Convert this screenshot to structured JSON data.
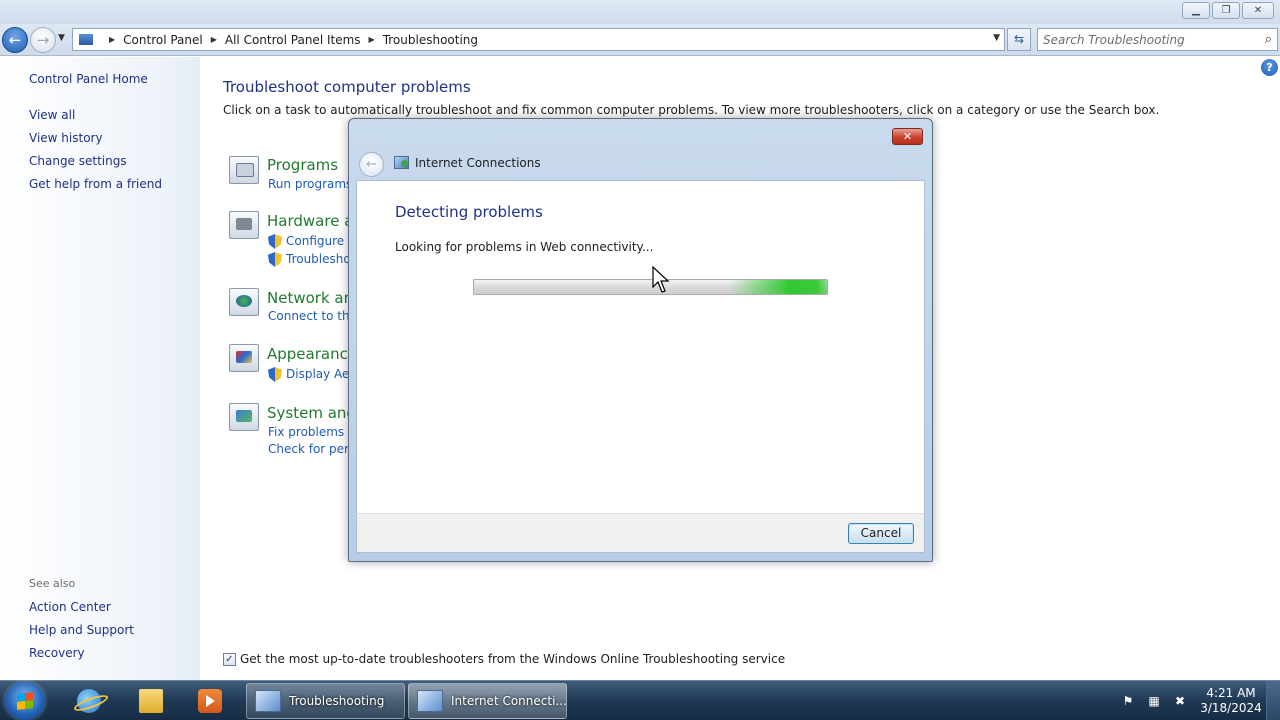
{
  "address": {
    "crumbs": [
      "Control Panel",
      "All Control Panel Items",
      "Troubleshooting"
    ],
    "search_placeholder": "Search Troubleshooting"
  },
  "left_pane": {
    "home": "Control Panel Home",
    "links": [
      "View all",
      "View history",
      "Change settings",
      "Get help from a friend"
    ],
    "see_also_label": "See also",
    "see_also": [
      "Action Center",
      "Help and Support",
      "Recovery"
    ]
  },
  "main": {
    "title": "Troubleshoot computer problems",
    "description": "Click on a task to automatically troubleshoot and fix common computer problems. To view more troubleshooters, click on a category or use the Search box.",
    "categories": [
      {
        "title": "Programs",
        "links": [
          "Run programs"
        ]
      },
      {
        "title": "Hardware a",
        "links": [
          "Configure a",
          "Troublesho"
        ]
      },
      {
        "title": "Network an",
        "links": [
          "Connect to the"
        ]
      },
      {
        "title": "Appearance",
        "links": [
          "Display Aero"
        ]
      },
      {
        "title": "System and",
        "links": [
          "Fix problems w",
          "Check for perfo"
        ]
      }
    ],
    "footer_checkbox_label": "Get the most up-to-date troubleshooters from the Windows Online Troubleshooting service",
    "footer_checked": true
  },
  "dialog": {
    "title": "Internet Connections",
    "heading": "Detecting problems",
    "status": "Looking for problems in Web connectivity...",
    "cancel_label": "Cancel",
    "progress_state": "indeterminate"
  },
  "taskbar": {
    "tasks": [
      "Troubleshooting",
      "Internet Connecti..."
    ],
    "time": "4:21 AM",
    "date": "3/18/2024"
  },
  "colors": {
    "link": "#1e5bb8",
    "heading": "#1e3287",
    "category_title": "#217a2f",
    "progress_glow": "#28c828"
  }
}
